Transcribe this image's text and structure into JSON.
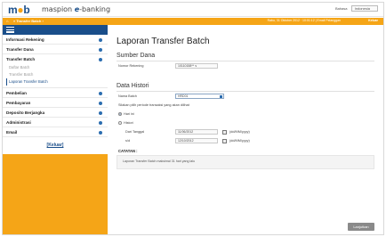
{
  "header": {
    "logo": "m",
    "logo_dot": "●",
    "logo_tail": "b",
    "brand_name": "maspion",
    "brand_e": "e",
    "brand_suffix": "-banking",
    "lang_label": "Bahasa",
    "lang_value": "Indonesia"
  },
  "topnav": {
    "home_icon": "house-icon",
    "breadcrumb": "» Transfer Batch ›",
    "info": "Rabu, 31 Oktober 2012 · 10:01:12 | Email Pelanggan",
    "logout": "Keluar"
  },
  "sidebar": {
    "items": [
      {
        "label": "Informasi Rekening"
      },
      {
        "label": "Transfer Dana"
      },
      {
        "label": "Transfer Batch"
      },
      {
        "label": "Pembelian"
      },
      {
        "label": "Pembayaran"
      },
      {
        "label": "Deposito Berjangka"
      },
      {
        "label": "Administrasi"
      },
      {
        "label": "Email"
      }
    ],
    "submenu": [
      "Daftar Batch",
      "Transfer Batch",
      "Laporan Transfer Batch"
    ],
    "keluar": "[Keluar]"
  },
  "main": {
    "title": "Laporan Transfer Batch",
    "sumber_section": "Sumber Dana",
    "nomor_label": "Nomor Rekening",
    "nomor_value": "10110158** ∨",
    "histori_section": "Data Histori",
    "nama_batch_label": "Nama Batch",
    "nama_batch_value": "HRD01",
    "period_instruction": "Silakan pilih periode transaksi yang akan dilihat",
    "option_today": "Hari ini",
    "option_history": "Histori",
    "dari_label": "Dari Tanggal",
    "dari_value": "11/06/2012",
    "sd_label": "s/d",
    "sd_value": "12/10/2012",
    "date_format": "(dd/MM/yyyy)",
    "catatan_label": "CATATAN :",
    "catatan_text": "Laporan Transfer Batch maksimal 31 hari yang lalu",
    "submit": "Lanjutkan"
  }
}
